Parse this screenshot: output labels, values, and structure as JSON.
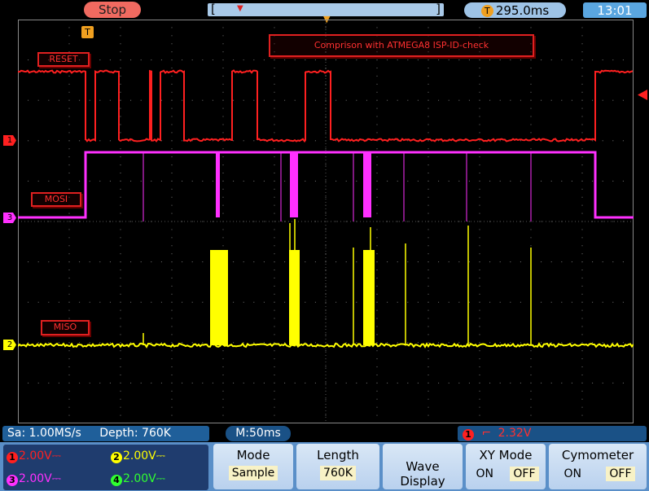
{
  "top": {
    "run_state": "Stop",
    "timebase_left": "[",
    "timebase_right": "]",
    "trigger_time": "295.0ms",
    "trigger_badge": "T",
    "clock": "13:01"
  },
  "annotations": {
    "title": "Comprison with ATMEGA8  ISP-ID-check",
    "reset": "RESET",
    "mosi": "MOSI",
    "miso": "MISO"
  },
  "markers": {
    "trigger": "T",
    "ch1": "1",
    "ch2": "2",
    "ch3": "3"
  },
  "info": {
    "sample_rate": "Sa: 1.00MS/s",
    "depth": "Depth: 760K",
    "timebase": "M:50ms",
    "trigger_channel": "1",
    "trigger_level": "2.32V"
  },
  "channels": [
    {
      "num": "1",
      "volt": "2.00V",
      "coupling": "⎓",
      "color": "#ff2020"
    },
    {
      "num": "2",
      "volt": "2.00V",
      "coupling": "⎓",
      "color": "#ffff00"
    },
    {
      "num": "3",
      "volt": "2.00V",
      "coupling": "⎓",
      "color": "#ff30ff"
    },
    {
      "num": "4",
      "volt": "2.00V",
      "coupling": "⎓",
      "color": "#30ff30"
    }
  ],
  "menu": {
    "mode_title": "Mode",
    "mode_value": "Sample",
    "length_title": "Length",
    "length_value": "760K",
    "wave_display": "Wave Display",
    "xy_title": "XY Mode",
    "xy_on": "ON",
    "xy_off": "OFF",
    "cym_title": "Cymometer",
    "cym_on": "ON",
    "cym_off": "OFF"
  },
  "colors": {
    "ch1": "#ff2020",
    "ch2": "#ffff00",
    "ch3": "#ff30ff",
    "ch4": "#30ff30",
    "accent": "#5a8fc8"
  }
}
